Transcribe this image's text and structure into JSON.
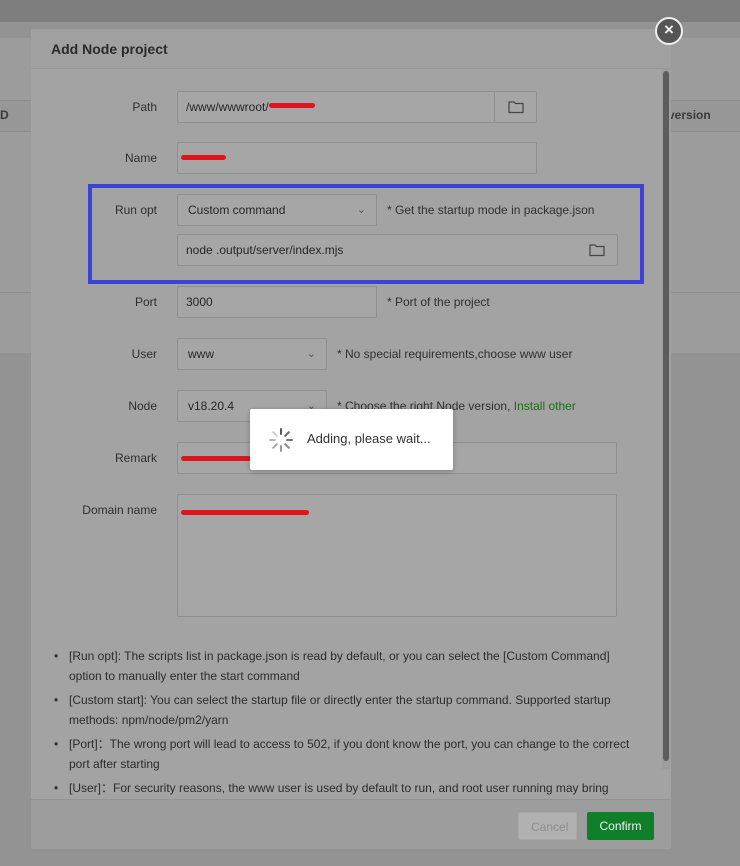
{
  "background": {
    "col_left": "D",
    "col_right": "version"
  },
  "dialog": {
    "title": "Add Node project",
    "close_icon": "close-icon"
  },
  "form": {
    "path": {
      "label": "Path",
      "value": "/www/wwwroot/",
      "icon": "folder-icon"
    },
    "name": {
      "label": "Name",
      "value": ""
    },
    "run_opt": {
      "label": "Run opt",
      "selected": "Custom command",
      "hint": "* Get the startup mode in package.json",
      "command": "node .output/server/index.mjs",
      "icon": "folder-icon"
    },
    "port": {
      "label": "Port",
      "value": "3000",
      "hint": "* Port of the project"
    },
    "user": {
      "label": "User",
      "selected": "www",
      "hint": "* No special requirements,choose www user"
    },
    "node": {
      "label": "Node",
      "selected": "v18.20.4",
      "hint": "* Choose the right Node version,",
      "hint_link": "Install other"
    },
    "remark": {
      "label": "Remark",
      "value": ""
    },
    "domain": {
      "label": "Domain name",
      "value": ""
    }
  },
  "notes": [
    "[Run opt]: The scripts list in package.json is read by default, or you can select the [Custom Command] option to manually enter the start command",
    "[Custom start]: You can select the startup file or directly enter the startup command. Supported startup methods: npm/node/pm2/yarn",
    "[Port]：The wrong port will lead to access to 502, if you dont know the port, you can change to the correct port after starting",
    "[User]：For security reasons, the www user is used by default to run, and root user running may bring"
  ],
  "footer": {
    "cancel_label": "Cancel",
    "confirm_label": "Confirm"
  },
  "loading": {
    "text": "Adding, please wait..."
  },
  "colors": {
    "accent": "#0f7f2a",
    "highlight": "#3d43d8",
    "redaction": "#e0141c"
  }
}
